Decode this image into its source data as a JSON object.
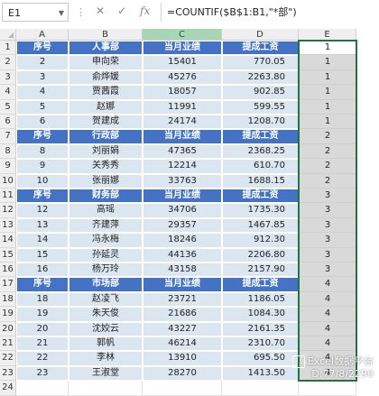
{
  "formula_bar": {
    "name_box": "E1",
    "formula": "=COUNTIF($B$1:B1,\"*部\")",
    "cancel_glyph": "✕",
    "confirm_glyph": "✓",
    "fx_label": "fx"
  },
  "columns": [
    "A",
    "B",
    "C",
    "D",
    "E"
  ],
  "rows": [
    {
      "type": "header",
      "cells": [
        "序号",
        "人事部",
        "当月业绩",
        "提成工资"
      ],
      "e": "1"
    },
    {
      "type": "data",
      "cells": [
        "2",
        "申向荣",
        "15401",
        "770.05"
      ],
      "e": "1"
    },
    {
      "type": "data",
      "cells": [
        "3",
        "俞烨媛",
        "45276",
        "2263.80"
      ],
      "e": "1"
    },
    {
      "type": "data",
      "cells": [
        "4",
        "贾茜霞",
        "18057",
        "902.85"
      ],
      "e": "1"
    },
    {
      "type": "data",
      "cells": [
        "5",
        "赵娜",
        "11991",
        "599.55"
      ],
      "e": "1"
    },
    {
      "type": "data",
      "cells": [
        "6",
        "贺建成",
        "24174",
        "1208.70"
      ],
      "e": "1"
    },
    {
      "type": "header",
      "cells": [
        "序号",
        "行政部",
        "当月业绩",
        "提成工资"
      ],
      "e": "2"
    },
    {
      "type": "data",
      "cells": [
        "8",
        "刘丽娟",
        "47365",
        "2368.25"
      ],
      "e": "2"
    },
    {
      "type": "data",
      "cells": [
        "9",
        "关秀秀",
        "12214",
        "610.70"
      ],
      "e": "2"
    },
    {
      "type": "data",
      "cells": [
        "10",
        "张丽娜",
        "33763",
        "1688.15"
      ],
      "e": "2"
    },
    {
      "type": "header",
      "cells": [
        "序号",
        "财务部",
        "当月业绩",
        "提成工资"
      ],
      "e": "3"
    },
    {
      "type": "data",
      "cells": [
        "12",
        "高瑶",
        "34706",
        "1735.30"
      ],
      "e": "3"
    },
    {
      "type": "data",
      "cells": [
        "13",
        "齐建萍",
        "29357",
        "1467.85"
      ],
      "e": "3"
    },
    {
      "type": "data",
      "cells": [
        "14",
        "冯永梅",
        "18246",
        "912.30"
      ],
      "e": "3"
    },
    {
      "type": "data",
      "cells": [
        "15",
        "孙延灵",
        "44136",
        "2206.80"
      ],
      "e": "3"
    },
    {
      "type": "data",
      "cells": [
        "16",
        "杨万玲",
        "43158",
        "2157.90"
      ],
      "e": "3"
    },
    {
      "type": "header",
      "cells": [
        "序号",
        "市场部",
        "当月业绩",
        "提成工资"
      ],
      "e": "4"
    },
    {
      "type": "data",
      "cells": [
        "18",
        "赵凌飞",
        "23721",
        "1186.05"
      ],
      "e": "4"
    },
    {
      "type": "data",
      "cells": [
        "19",
        "朱天俊",
        "21686",
        "1084.30"
      ],
      "e": "4"
    },
    {
      "type": "data",
      "cells": [
        "20",
        "沈姣云",
        "43227",
        "2161.35"
      ],
      "e": "4"
    },
    {
      "type": "data",
      "cells": [
        "21",
        "郭帆",
        "46214",
        "2310.70"
      ],
      "e": "4"
    },
    {
      "type": "data",
      "cells": [
        "22",
        "李林",
        "13910",
        "695.50"
      ],
      "e": "4"
    },
    {
      "type": "data",
      "cells": [
        "23",
        "王淑堂",
        "28270",
        "1413.50"
      ],
      "e": "4"
    }
  ],
  "row_numbers": [
    "1",
    "2",
    "3",
    "4",
    "5",
    "6",
    "7",
    "8",
    "9",
    "10",
    "11",
    "12",
    "13",
    "14",
    "15",
    "16",
    "17",
    "18",
    "19",
    "20",
    "21",
    "22",
    "23",
    "24"
  ],
  "watermark": {
    "line1": "Excel数据平台",
    "line2": "D:77/8/2290"
  },
  "colors": {
    "header_fill": "#4472c4",
    "data_fill": "#dce6f1",
    "selection": "#217346",
    "selected_col_header": "#a8d5b5"
  }
}
